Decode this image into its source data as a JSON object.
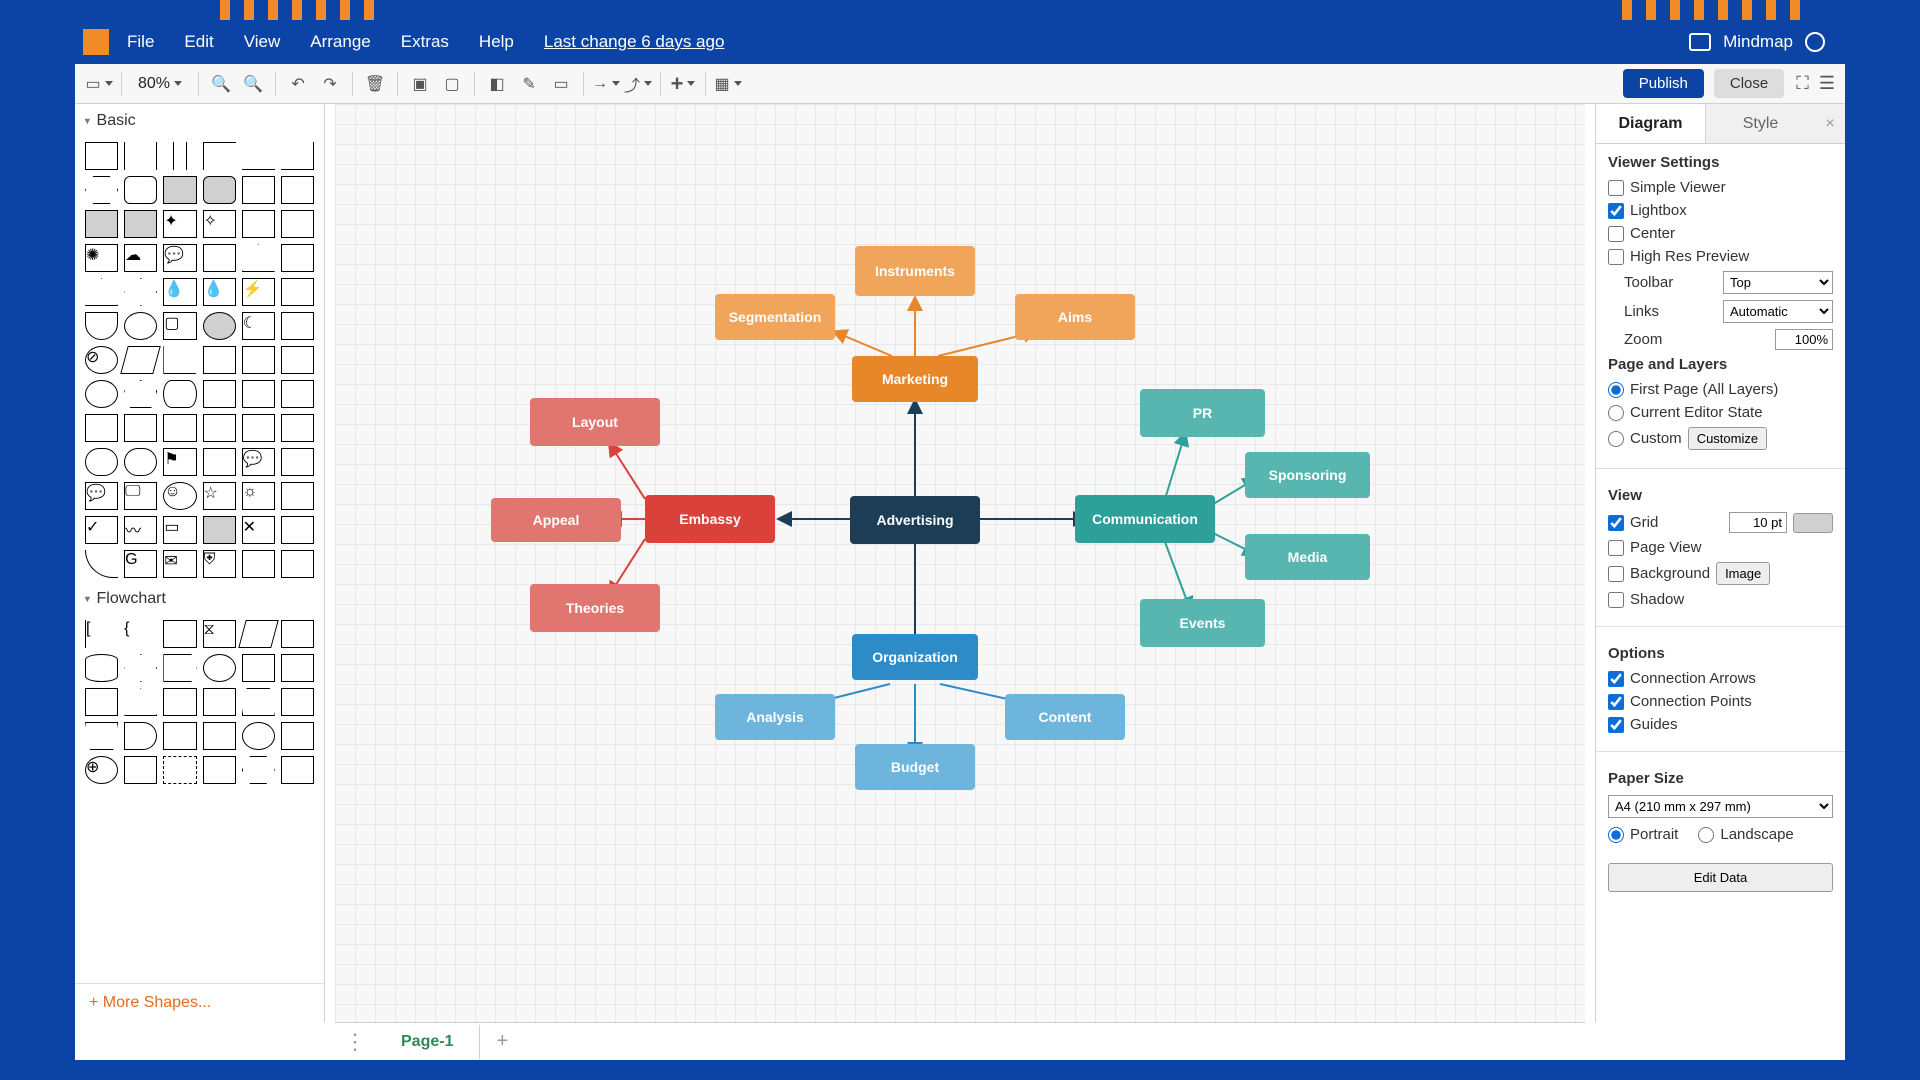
{
  "app_name": "Mindmap",
  "menu": {
    "file": "File",
    "edit": "Edit",
    "view": "View",
    "arrange": "Arrange",
    "extras": "Extras",
    "help": "Help",
    "last_change": "Last change 6 days ago"
  },
  "toolbar": {
    "zoom": "80%",
    "publish": "Publish",
    "close": "Close"
  },
  "shapes": {
    "basic_header": "Basic",
    "flowchart_header": "Flowchart",
    "more": "+ More Shapes..."
  },
  "canvas": {
    "center": {
      "label": "Advertising",
      "color": "#1d3d56"
    },
    "marketing": {
      "label": "Marketing",
      "color": "#e8862a",
      "children": [
        {
          "label": "Segmentation"
        },
        {
          "label": "Instruments"
        },
        {
          "label": "Aims"
        }
      ]
    },
    "embassy": {
      "label": "Embassy",
      "color": "#d9413a",
      "children": [
        {
          "label": "Layout"
        },
        {
          "label": "Appeal"
        },
        {
          "label": "Theories"
        }
      ],
      "child_color": "#e0766f"
    },
    "organization": {
      "label": "Organization",
      "color": "#2d8bc8",
      "children": [
        {
          "label": "Analysis"
        },
        {
          "label": "Budget"
        },
        {
          "label": "Content"
        }
      ],
      "child_color": "#6db5dd"
    },
    "communication": {
      "label": "Communication",
      "color": "#2da099",
      "children": [
        {
          "label": "PR"
        },
        {
          "label": "Sponsoring"
        },
        {
          "label": "Media"
        },
        {
          "label": "Events"
        }
      ],
      "child_color": "#57b7b0"
    }
  },
  "rpanel": {
    "tab_diagram": "Diagram",
    "tab_style": "Style",
    "viewer_settings": "Viewer Settings",
    "simple_viewer": "Simple Viewer",
    "lightbox": "Lightbox",
    "center": "Center",
    "high_res": "High Res Preview",
    "toolbar_label": "Toolbar",
    "toolbar_val": "Top",
    "links_label": "Links",
    "links_val": "Automatic",
    "zoom_label": "Zoom",
    "zoom_val": "100%",
    "page_layers": "Page and Layers",
    "first_page": "First Page (All Layers)",
    "editor_state": "Current Editor State",
    "custom": "Custom",
    "customize": "Customize",
    "view": "View",
    "grid": "Grid",
    "grid_val": "10 pt",
    "page_view": "Page View",
    "background": "Background",
    "image_btn": "Image",
    "shadow": "Shadow",
    "options": "Options",
    "conn_arrows": "Connection Arrows",
    "conn_points": "Connection Points",
    "guides": "Guides",
    "paper_size": "Paper Size",
    "paper_val": "A4 (210 mm x 297 mm)",
    "portrait": "Portrait",
    "landscape": "Landscape",
    "edit_data": "Edit Data"
  },
  "footer": {
    "page1": "Page-1"
  }
}
